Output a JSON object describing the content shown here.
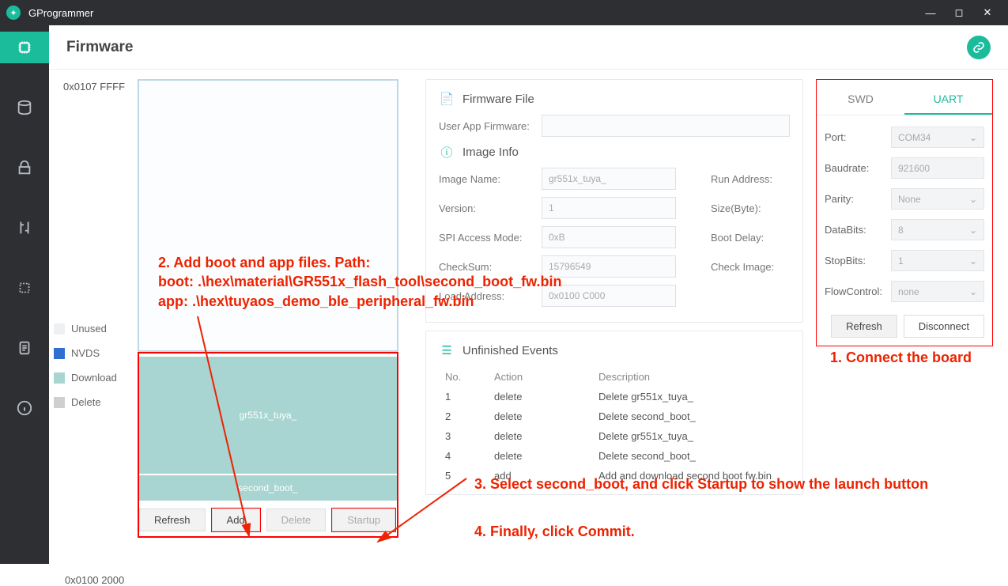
{
  "app_title": "GProgrammer",
  "page_title": "Firmware",
  "mem": {
    "addr_top": "0x0107 FFFF",
    "addr_bottom": "0x0100 2000",
    "legend": {
      "unused": "Unused",
      "nvds": "NVDS",
      "download": "Download",
      "delete": "Delete"
    },
    "blocks": [
      {
        "label": "gr551x_tuya_",
        "h": 150
      },
      {
        "label": "second_boot_",
        "h": 34
      }
    ],
    "buttons": {
      "refresh": "Refresh",
      "add": "Add",
      "delete": "Delete",
      "startup": "Startup"
    }
  },
  "fw": {
    "panel_title": "Firmware File",
    "user_app_label": "User App Firmware:",
    "info_title": "Image Info",
    "image_name_label": "Image Name:",
    "image_name": "gr551x_tuya_",
    "version_label": "Version:",
    "version": "1",
    "spi_label": "SPI Access Mode:",
    "spi": "0xB",
    "checksum_label": "CheckSum:",
    "checksum": "15796549",
    "load_label": "Load Address:",
    "load": "0x0100 C000",
    "run_label": "Run Address:",
    "size_label": "Size(Byte):",
    "bootdelay_label": "Boot Delay:",
    "checkimg_label": "Check Image:"
  },
  "events": {
    "title": "Unfinished Events",
    "cols": {
      "no": "No.",
      "action": "Action",
      "desc": "Description"
    },
    "rows": [
      {
        "no": "1",
        "action": "delete",
        "desc": "Delete gr551x_tuya_"
      },
      {
        "no": "2",
        "action": "delete",
        "desc": "Delete second_boot_"
      },
      {
        "no": "3",
        "action": "delete",
        "desc": "Delete gr551x_tuya_"
      },
      {
        "no": "4",
        "action": "delete",
        "desc": "Delete second_boot_"
      },
      {
        "no": "5",
        "action": "add",
        "desc": "Add and download second boot fw.bin"
      }
    ]
  },
  "conn": {
    "tabs": {
      "swd": "SWD",
      "uart": "UART"
    },
    "port_label": "Port:",
    "port": "COM34",
    "baud_label": "Baudrate:",
    "baud": "921600",
    "parity_label": "Parity:",
    "parity": "None",
    "databits_label": "DataBits:",
    "databits": "8",
    "stopbits_label": "StopBits:",
    "stopbits": "1",
    "flow_label": "FlowControl:",
    "flow": "none",
    "refresh": "Refresh",
    "disconnect": "Disconnect"
  },
  "anno": {
    "a1": "1. Connect the board",
    "a2a": "2. Add boot and app files. Path:",
    "a2b": "boot:  .\\hex\\material\\GR551x_flash_tool\\second_boot_fw.bin",
    "a2c": "app:   .\\hex\\tuyaos_demo_ble_peripheral_fw.bin",
    "a3": "3. Select second_boot, and click Startup to show the launch button",
    "a4": "4. Finally, click Commit."
  }
}
